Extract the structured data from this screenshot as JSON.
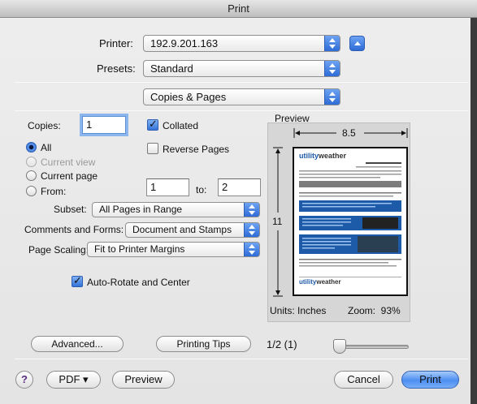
{
  "window": {
    "title": "Print"
  },
  "printer": {
    "label": "Printer:",
    "value": "192.9.201.163"
  },
  "presets": {
    "label": "Presets:",
    "value": "Standard"
  },
  "section": {
    "value": "Copies & Pages"
  },
  "copies": {
    "label": "Copies:",
    "value": "1"
  },
  "collated": {
    "label": "Collated",
    "checked": true
  },
  "reverse_pages": {
    "label": "Reverse Pages",
    "checked": false
  },
  "range": {
    "options": [
      {
        "label": "All",
        "selected": true,
        "enabled": true
      },
      {
        "label": "Current view",
        "selected": false,
        "enabled": false
      },
      {
        "label": "Current page",
        "selected": false,
        "enabled": true
      },
      {
        "label": "From:",
        "selected": false,
        "enabled": true
      }
    ],
    "from_value": "1",
    "to_label": "to:",
    "to_value": "2"
  },
  "subset": {
    "label": "Subset:",
    "value": "All Pages in Range"
  },
  "comments_forms": {
    "label": "Comments and Forms:",
    "value": "Document and Stamps"
  },
  "page_scaling": {
    "label": "Page Scaling:",
    "value": "Fit to Printer Margins"
  },
  "auto_rotate": {
    "label": "Auto-Rotate and Center",
    "checked": true
  },
  "preview": {
    "title": "Preview",
    "width_label": "8.5",
    "height_label": "11",
    "units": "Units: Inches",
    "zoom": "Zoom:  93%",
    "page_indicator": "1/2 (1)",
    "thumb_logo_a": "utility",
    "thumb_logo_b": "weather",
    "thumb_band": "Common Issues and Solutions",
    "thumb_footer_a": "utility",
    "thumb_footer_b": "weather"
  },
  "buttons": {
    "advanced": "Advanced...",
    "printing_tips": "Printing Tips",
    "help": "?",
    "pdf": "PDF ▾",
    "preview": "Preview",
    "cancel": "Cancel",
    "print": "Print"
  },
  "colors": {
    "accent": "#2e6bd6",
    "default_button": "#4d8ef0",
    "thumb_blue": "#1d5aa8"
  }
}
